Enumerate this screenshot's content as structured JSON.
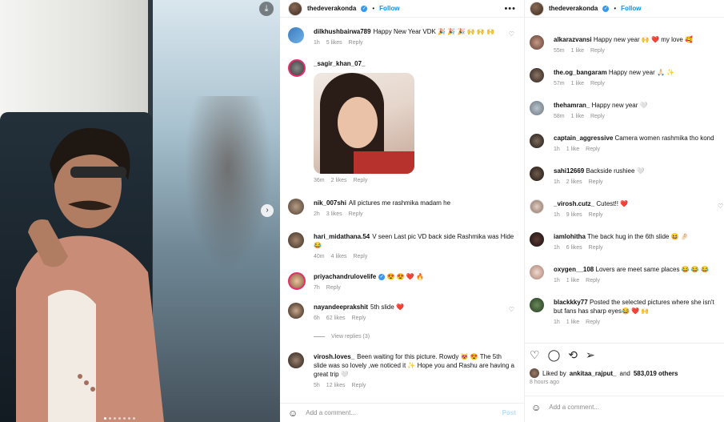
{
  "photo": {
    "download_icon": "download-icon",
    "next_icon": "chevron-right-icon"
  },
  "middle": {
    "header": {
      "username": "thedeverakonda",
      "dot": "•",
      "follow": "Follow",
      "more": "•••"
    },
    "comments": [
      {
        "user": "dilkhushbairwa789",
        "text": "Happy New Year VDK 🎉 🎉 🎉 🙌 🙌 🙌",
        "time": "1h",
        "likes": "5 likes",
        "reply": "Reply"
      },
      {
        "user": "_sagir_khan_07_",
        "text": "",
        "time": "36m",
        "likes": "2 likes",
        "reply": "Reply"
      },
      {
        "user": "nik_007shi",
        "text": "All pictures me rashmika madam he",
        "time": "2h",
        "likes": "3 likes",
        "reply": "Reply"
      },
      {
        "user": "hari_midathana.54",
        "text": "V seen Last pic VD back side Rashmika was Hide😂",
        "time": "40m",
        "likes": "4 likes",
        "reply": "Reply"
      },
      {
        "user": "priyachandrulovelife",
        "text": "😍 😍 ❤️ 🔥",
        "time": "7h",
        "likes": "",
        "reply": "Reply"
      },
      {
        "user": "nayandeeprakshit",
        "text": "5th slide ❤️",
        "time": "6h",
        "likes": "62 likes",
        "reply": "Reply"
      },
      {
        "user": "virosh.loves_",
        "text": "Been waiting for this picture. Rowdy 😻 😍 The 5th slide was so lovely ,we noticed it ✨ Hope you and Rashu are having a great trip 🤍",
        "time": "5h",
        "likes": "12 likes",
        "reply": "Reply"
      }
    ],
    "view_replies": "View replies (3)",
    "add_comment": "Add a comment...",
    "post": "Post"
  },
  "right": {
    "header": {
      "username": "thedeverakonda",
      "dot": "•",
      "follow": "Follow"
    },
    "comments": [
      {
        "user": "alkarazvansi",
        "text": "Happy new year 🙌 ❤️ my love 🥰",
        "time": "55m",
        "likes": "1 like",
        "reply": "Reply"
      },
      {
        "user": "the.og_bangaram",
        "text": "Happy new year 🙏🏻 ✨",
        "time": "57m",
        "likes": "1 like",
        "reply": "Reply"
      },
      {
        "user": "thehamran_",
        "text": "Happy new year 🤍",
        "time": "58m",
        "likes": "1 like",
        "reply": "Reply"
      },
      {
        "user": "captain_aggressive",
        "text": "Camera women rashmika tho kond",
        "time": "1h",
        "likes": "1 like",
        "reply": "Reply"
      },
      {
        "user": "sahi12669",
        "text": "Backside rushiee 🤍",
        "time": "1h",
        "likes": "2 likes",
        "reply": "Reply"
      },
      {
        "user": "_virosh.cutz_",
        "text": "Cutest!! ❤️",
        "time": "1h",
        "likes": "9 likes",
        "reply": "Reply"
      },
      {
        "user": "iamlohitha",
        "text": "The back hug in the 6th slide 😆 🤌🏻",
        "time": "1h",
        "likes": "6 likes",
        "reply": "Reply"
      },
      {
        "user": "oxygen__108",
        "text": "Lovers are meet same places 😂 😂 😂",
        "time": "1h",
        "likes": "1 like",
        "reply": "Reply"
      },
      {
        "user": "blackkky77",
        "text": "Posted the selected pictures where she isn't but fans has sharp eyes😂 ❤️ 🙌",
        "time": "1h",
        "likes": "1 like",
        "reply": "Reply"
      }
    ],
    "liked_by": {
      "prefix": "Liked by",
      "user": "ankitaa_rajput_",
      "mid": "and",
      "count": "583,019 others"
    },
    "date": "8 hours ago",
    "add_comment": "Add a comment..."
  },
  "colors": {
    "link_blue": "#0095f6",
    "muted": "#8e8e8e"
  }
}
